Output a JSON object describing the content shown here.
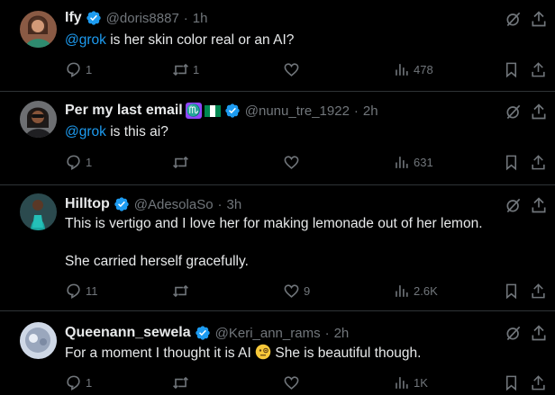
{
  "tweets": [
    {
      "name": "Ify",
      "handle": "@doris8887",
      "time": "1h",
      "mention": "@grok",
      "text": " is her skin color real or an AI?",
      "replies": "1",
      "retweets": "1",
      "likes": "",
      "views": "478"
    },
    {
      "name": "Per my last email",
      "name_emoji": "♏",
      "name_flag": "🇳🇬",
      "handle": "@nunu_tre_1922",
      "time": "2h",
      "mention": "@grok",
      "text": " is this ai?",
      "replies": "1",
      "retweets": "",
      "likes": "",
      "views": "631"
    },
    {
      "name": "Hilltop",
      "handle": "@AdesolaSo",
      "time": "3h",
      "text": "This is vertigo and I love her for making lemonade out of her lemon.",
      "text2": "She carried herself gracefully.",
      "replies": "11",
      "retweets": "",
      "likes": "9",
      "views": "2.6K"
    },
    {
      "name": "Queenann_sewela",
      "handle": "@Keri_ann_rams",
      "time": "2h",
      "text_before": "For a moment I thought it is AI ",
      "emoji": "face-with-monocle",
      "text_after": " She is beautiful though.",
      "replies": "1",
      "retweets": "",
      "likes": "",
      "views": "1K"
    }
  ],
  "separator": "·",
  "colors": {
    "background": "#000000",
    "text": "#e7e9ea",
    "muted": "#71767b",
    "accent": "#1d9bf0",
    "divider": "#2f3336"
  },
  "icons": [
    "grok-icon",
    "more-icon",
    "reply-icon",
    "retweet-icon",
    "like-icon",
    "views-icon",
    "bookmark-icon",
    "share-icon",
    "verified-badge-icon"
  ]
}
